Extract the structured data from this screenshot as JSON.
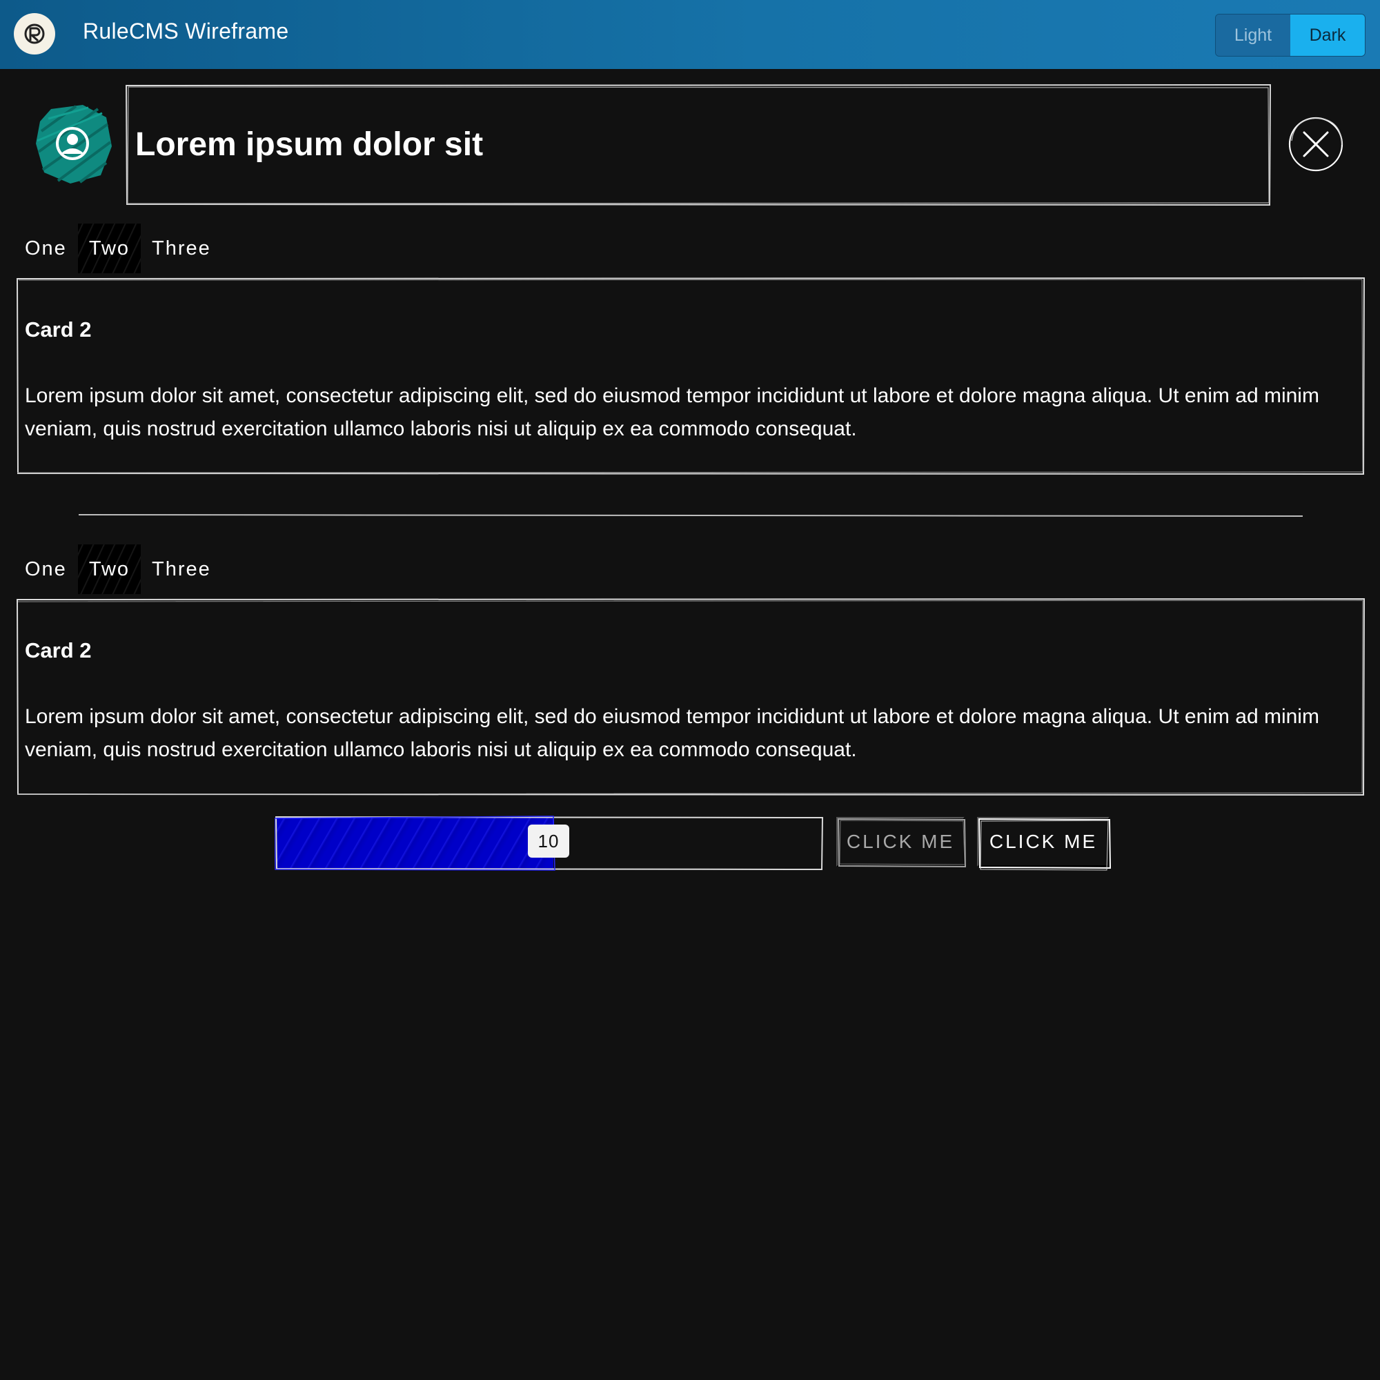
{
  "header": {
    "app_title": "RuleCMS Wireframe",
    "theme_toggle": {
      "light_label": "Light",
      "dark_label": "Dark",
      "selected": "Dark"
    }
  },
  "title_section": {
    "title": "Lorem ipsum dolor sit",
    "avatar_icon": "user-circle-icon",
    "close_icon": "close-icon"
  },
  "tabs_1": {
    "items": [
      {
        "label": "One"
      },
      {
        "label": "Two"
      },
      {
        "label": "Three"
      }
    ],
    "active_index": 1
  },
  "card_1": {
    "title": "Card 2",
    "body": "Lorem ipsum dolor sit amet, consectetur adipiscing elit, sed do eiusmod tempor incididunt ut labore et dolore magna aliqua. Ut enim ad minim veniam, quis nostrud exercitation ullamco laboris nisi ut aliquip ex ea commodo consequat."
  },
  "tabs_2": {
    "items": [
      {
        "label": "One"
      },
      {
        "label": "Two"
      },
      {
        "label": "Three"
      }
    ],
    "active_index": 1
  },
  "card_2": {
    "title": "Card 2",
    "body": "Lorem ipsum dolor sit amet, consectetur adipiscing elit, sed do eiusmod tempor incididunt ut labore et dolore magna aliqua. Ut enim ad minim veniam, quis nostrud exercitation ullamco laboris nisi ut aliquip ex ea commodo consequat."
  },
  "controls": {
    "slider_value": "10",
    "slider_fraction": 0.5,
    "button_1_label": "CLICK ME",
    "button_2_label": "CLICK ME"
  },
  "colors": {
    "header_bg": "#1672a8",
    "page_bg": "#111111",
    "dark_toggle": "#1ab0ee",
    "avatar": "#0f8a80",
    "progress_fill": "#0000c8"
  }
}
